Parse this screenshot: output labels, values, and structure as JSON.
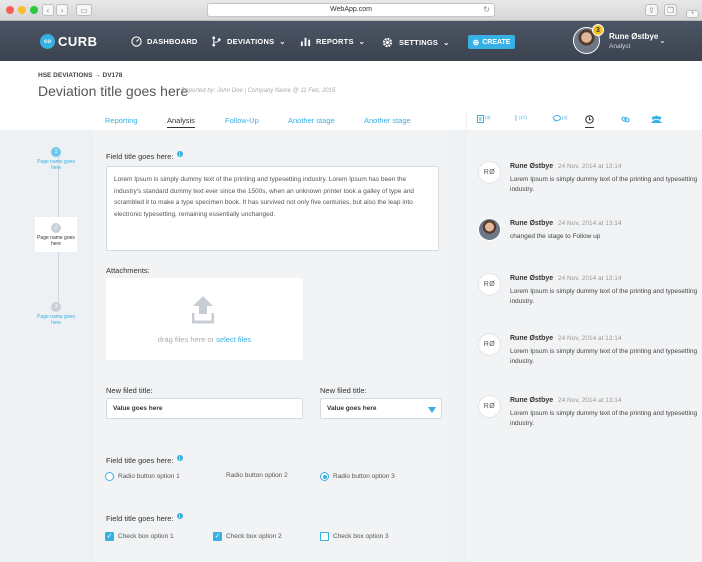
{
  "browser": {
    "url": "WebApp.com"
  },
  "app": {
    "logo_mark": "co",
    "logo_text": "CURB",
    "nav": [
      {
        "label": "DASHBOARD",
        "icon": "dashboard-icon"
      },
      {
        "label": "DEVIATIONS",
        "icon": "branch-icon"
      },
      {
        "label": "REPORTS",
        "icon": "bar-chart-icon"
      },
      {
        "label": "SETTINGS",
        "icon": "gear-icon"
      }
    ],
    "create_label": "CREATE",
    "user": {
      "name": "Rune Østbye",
      "role": "Analyst",
      "notifications": "3"
    },
    "accent": "#37b0e4"
  },
  "header": {
    "breadcrumb": "HSE DEVIATIONS → DV178",
    "title": "Deviation title goes here",
    "meta": "Reported by: John Doe | Company Name @ 11 Feb, 2015"
  },
  "tabs": [
    "Reporting",
    "Analysis",
    "Follow-Up",
    "Another stage",
    "Another stage"
  ],
  "active_tab": "Analysis",
  "right_tabs": [
    {
      "icon": "document-icon",
      "count": "(3)"
    },
    {
      "icon": "paperclip-icon",
      "count": "(17)"
    },
    {
      "icon": "comment-icon",
      "count": "(4)"
    },
    {
      "icon": "clock-icon",
      "count": ""
    },
    {
      "icon": "link-icon",
      "count": ""
    },
    {
      "icon": "users-icon",
      "count": ""
    }
  ],
  "steps": [
    {
      "num": "1",
      "label": "Page name goes here"
    },
    {
      "num": "2",
      "label": "Page name goes here"
    },
    {
      "num": "3",
      "label": "Page name goes here"
    }
  ],
  "form": {
    "field1_label": "Field title goes here:",
    "description": "Lorem Ipsum is simply dummy text of the printing and typesetting industry. Lorem Ipsum has been the industry's standard dummy text ever since the 1500s, when an unknown printer took a galley of type and scrambled it to make a type specimen book. It has survived not only five centuries, but also the leap into electronic typesetting, remaining essentially unchanged.",
    "attachments_label": "Attachments:",
    "drop_text": "drag files here or",
    "drop_link": "select files",
    "new_field_label_1": "New filed title:",
    "new_field_value_1": "Value goes here",
    "new_field_label_2": "New filed title:",
    "new_field_value_2": "Value goes here",
    "radio_label": "Field title goes here:",
    "radios": [
      "Radio button option 1",
      "Radio button option 2",
      "Radio button option 3"
    ],
    "radio_selected": 3,
    "check_label": "Field title goes here:",
    "checks": [
      {
        "label": "Check box option 1",
        "checked": true
      },
      {
        "label": "Check box option 2",
        "checked": true
      },
      {
        "label": "Check box option 3",
        "checked": false
      }
    ]
  },
  "feed": [
    {
      "initials": "RØ",
      "photo": false,
      "name": "Rune Østbye",
      "date": "24 Nov, 2014 at 13:14",
      "text": "Lorem Ipsum is simply dummy text of the printing and typesetting industry."
    },
    {
      "initials": "",
      "photo": true,
      "name": "Rune Østbye",
      "date": "24 Nov, 2014 at 13:14",
      "text": "changed the stage to Follow up"
    },
    {
      "initials": "RØ",
      "photo": false,
      "name": "Rune Østbye",
      "date": "24 Nov, 2014 at 13:14",
      "text": "Lorem Ipsum is simply dummy text of the printing and typesetting industry."
    },
    {
      "initials": "RØ",
      "photo": false,
      "name": "Rune Østbye",
      "date": "24 Nov, 2014 at 13:14",
      "text": "Lorem Ipsum is simply dummy text of the printing and typesetting industry."
    },
    {
      "initials": "RØ",
      "photo": false,
      "name": "Rune Østbye",
      "date": "24 Nov, 2014 at 13:14",
      "text": "Lorem Ipsum is simply dummy text of the printing and typesetting industry."
    }
  ]
}
